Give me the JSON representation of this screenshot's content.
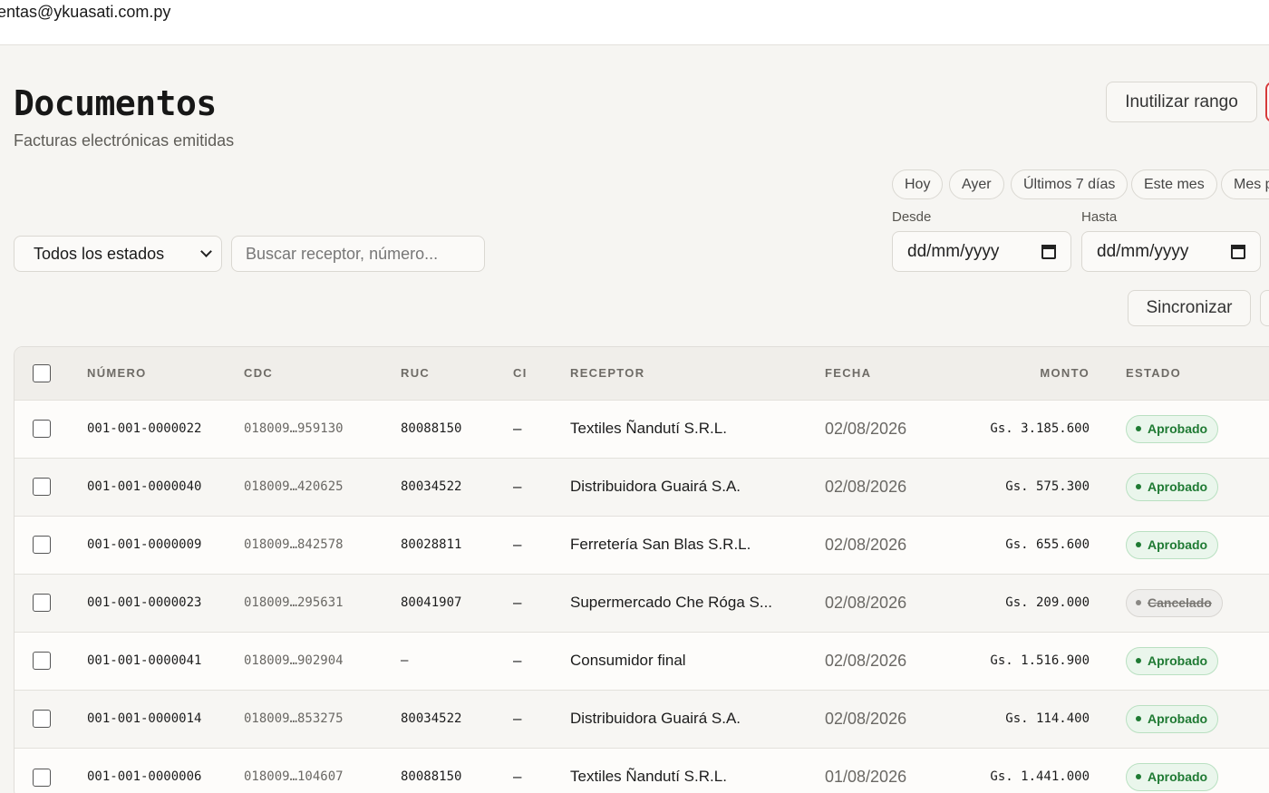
{
  "topbar": {
    "user_email": "ventas@ykuasati.com.py"
  },
  "header": {
    "title": "Documentos",
    "subtitle": "Facturas electrónicas emitidas",
    "inutilizar_label": "Inutilizar rango"
  },
  "date_filters": {
    "chips": [
      "Hoy",
      "Ayer",
      "Últimos 7 días",
      "Este mes",
      "Mes pasado"
    ],
    "desde_label": "Desde",
    "hasta_label": "Hasta",
    "desde_value": "dd/mm/yyyy",
    "hasta_value": "dd/mm/yyyy"
  },
  "filters": {
    "estado_selected": "Todos los estados",
    "search_placeholder": "Buscar receptor, número..."
  },
  "actions": {
    "sync_label": "Sincronizar"
  },
  "table": {
    "columns": [
      "NÚMERO",
      "CDC",
      "RUC",
      "CI",
      "RECEPTOR",
      "FECHA",
      "MONTO",
      "ESTADO"
    ],
    "rows": [
      {
        "numero": "001-001-0000022",
        "cdc": "018009…959130",
        "ruc": "80088150",
        "ci": "–",
        "receptor": "Textiles Ñandutí S.R.L.",
        "fecha": "02/08/2026",
        "monto": "Gs. 3.185.600",
        "estado": "Aprobado"
      },
      {
        "numero": "001-001-0000040",
        "cdc": "018009…420625",
        "ruc": "80034522",
        "ci": "–",
        "receptor": "Distribuidora Guairá S.A.",
        "fecha": "02/08/2026",
        "monto": "Gs. 575.300",
        "estado": "Aprobado"
      },
      {
        "numero": "001-001-0000009",
        "cdc": "018009…842578",
        "ruc": "80028811",
        "ci": "–",
        "receptor": "Ferretería San Blas S.R.L.",
        "fecha": "02/08/2026",
        "monto": "Gs. 655.600",
        "estado": "Aprobado"
      },
      {
        "numero": "001-001-0000023",
        "cdc": "018009…295631",
        "ruc": "80041907",
        "ci": "–",
        "receptor": "Supermercado Che Róga S...",
        "fecha": "02/08/2026",
        "monto": "Gs. 209.000",
        "estado": "Cancelado"
      },
      {
        "numero": "001-001-0000041",
        "cdc": "018009…902904",
        "ruc": "–",
        "ci": "–",
        "receptor": "Consumidor final",
        "fecha": "02/08/2026",
        "monto": "Gs. 1.516.900",
        "estado": "Aprobado"
      },
      {
        "numero": "001-001-0000014",
        "cdc": "018009…853275",
        "ruc": "80034522",
        "ci": "–",
        "receptor": "Distribuidora Guairá S.A.",
        "fecha": "02/08/2026",
        "monto": "Gs. 114.400",
        "estado": "Aprobado"
      },
      {
        "numero": "001-001-0000006",
        "cdc": "018009…104607",
        "ruc": "80088150",
        "ci": "–",
        "receptor": "Textiles Ñandutí S.R.L.",
        "fecha": "01/08/2026",
        "monto": "Gs. 1.441.000",
        "estado": "Aprobado"
      }
    ]
  },
  "colors": {
    "approved": "#1f7a33",
    "cancel": "#7a7874",
    "danger": "#d63a3a"
  }
}
